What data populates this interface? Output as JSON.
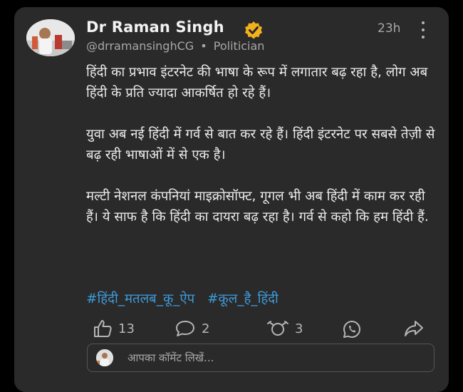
{
  "post": {
    "author_name": "Dr Raman Singh",
    "handle": "@drramansinghCG",
    "separator": "•",
    "role": "Politician",
    "time": "23h",
    "paragraphs": [
      "हिंदी का प्रभाव इंटरनेट की भाषा के रूप में लगातार बढ़ रहा है, लोग अब हिंदी के प्रति ज्यादा आकर्षित हो रहे हैं।",
      "युवा अब नई हिंदी में गर्व से बात कर रहे हैं। हिंदी इंटरनेट पर सबसे तेज़ी से बढ़ रही भाषाओं में से एक है।",
      "मल्टी नेशनल कंपनियां माइक्रोसॉफ्ट, गूगल भी अब हिंदी में काम कर रही हैं। ये साफ है कि हिंदी का दायरा बढ़ रहा है। गर्व से कहो कि हम हिंदी हैं."
    ],
    "hashtags": [
      "#हिंदी_मतलब_कू_ऐप",
      "#कूल_है_हिंदी"
    ]
  },
  "actions": {
    "likes": "13",
    "comments": "2",
    "rekoos": "3"
  },
  "comment": {
    "placeholder": "आपका कॉमेंट लिखें..."
  },
  "colors": {
    "background": "#000000",
    "card": "#2a2a2a",
    "hashtag": "#3d9bdc",
    "verified_badge": "#f2b01e"
  },
  "icons": [
    "more-vertical-icon",
    "verified-badge-icon",
    "like-icon",
    "comment-icon",
    "rekoo-icon",
    "whatsapp-icon",
    "share-icon"
  ]
}
